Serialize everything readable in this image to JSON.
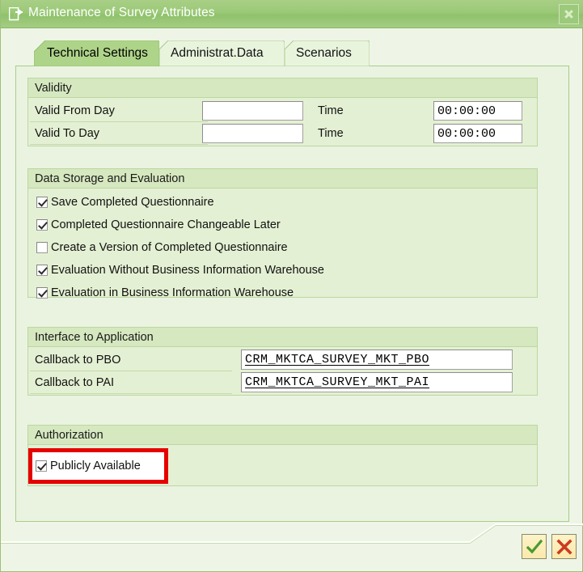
{
  "window": {
    "title": "Maintenance of Survey Attributes",
    "title_icon": "dialog-exit-icon",
    "close_icon": "close-x-icon"
  },
  "tabs": [
    {
      "label": "Technical Settings",
      "active": true
    },
    {
      "label": "Administrat.Data",
      "active": false
    },
    {
      "label": "Scenarios",
      "active": false
    }
  ],
  "sections": {
    "validity": {
      "title": "Validity",
      "rows": [
        {
          "label": "Valid From Day",
          "value": "",
          "time_label": "Time",
          "time_value": "00:00:00"
        },
        {
          "label": "Valid To Day",
          "value": "",
          "time_label": "Time",
          "time_value": "00:00:00"
        }
      ]
    },
    "data_storage": {
      "title": "Data Storage and Evaluation",
      "checkboxes": [
        {
          "label": "Save Completed Questionnaire",
          "checked": true
        },
        {
          "label": "Completed Questionnaire Changeable Later",
          "checked": true
        },
        {
          "label": "Create a Version of Completed Questionnaire",
          "checked": false
        },
        {
          "label": "Evaluation Without Business Information Warehouse",
          "checked": true
        },
        {
          "label": "Evaluation in Business Information Warehouse",
          "checked": true
        }
      ]
    },
    "interface": {
      "title": "Interface to Application",
      "rows": [
        {
          "label": "Callback to PBO",
          "value": "CRM_MKTCA_SURVEY_MKT_PBO"
        },
        {
          "label": "Callback to PAI",
          "value": "CRM_MKTCA_SURVEY_MKT_PAI"
        }
      ]
    },
    "authorization": {
      "title": "Authorization",
      "checkbox": {
        "label": "Publicly Available",
        "checked": true
      },
      "highlighted": true
    }
  },
  "footer": {
    "confirm_icon": "green-check-icon",
    "cancel_icon": "red-x-icon"
  },
  "colors": {
    "titlebar": "#9bc977",
    "panel_bg": "#eaf3e0",
    "group_bg": "#e4f0d3",
    "group_header_bg": "#d6e8bf",
    "annotation_red": "#e60000",
    "confirm_green": "#4a9b2f",
    "cancel_red": "#cc3b1e"
  }
}
